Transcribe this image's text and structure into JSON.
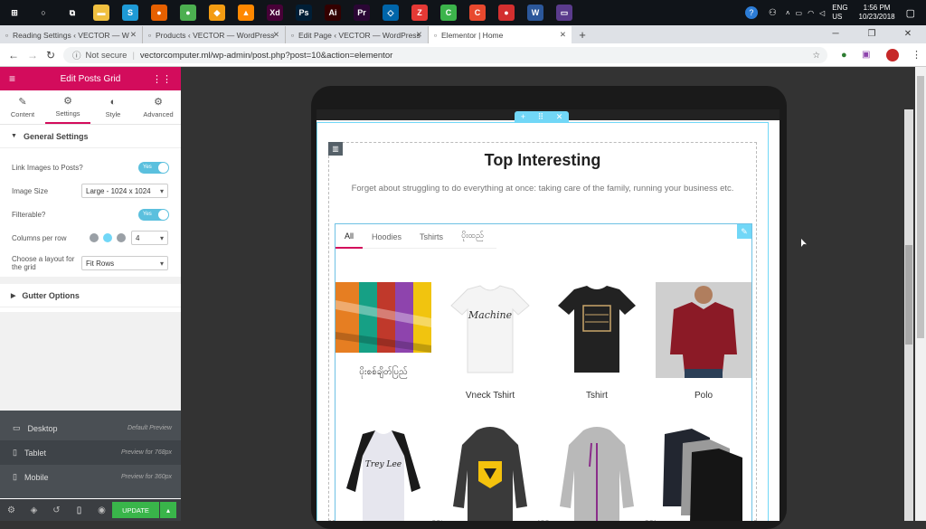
{
  "taskbar": {
    "apps": [
      {
        "name": "windows-icon",
        "glyph": "⊞",
        "color": "#101419"
      },
      {
        "name": "cortana-icon",
        "glyph": "○",
        "color": "#101419"
      },
      {
        "name": "taskview-icon",
        "glyph": "⧉",
        "color": "#101419"
      },
      {
        "name": "file-explorer-icon",
        "glyph": "▬",
        "color": "#f0c040"
      },
      {
        "name": "app-s-icon",
        "glyph": "S",
        "color": "#1e9ad6"
      },
      {
        "name": "firefox-icon",
        "glyph": "●",
        "color": "#e66000"
      },
      {
        "name": "chrome-icon",
        "glyph": "●",
        "color": "#4caf50"
      },
      {
        "name": "fl-studio-icon",
        "glyph": "◆",
        "color": "#f39c12"
      },
      {
        "name": "vlc-icon",
        "glyph": "▲",
        "color": "#ff8800"
      },
      {
        "name": "adobe-xd-icon",
        "glyph": "Xd",
        "color": "#470137"
      },
      {
        "name": "photoshop-icon",
        "glyph": "Ps",
        "color": "#001e36"
      },
      {
        "name": "illustrator-icon",
        "glyph": "Ai",
        "color": "#330000"
      },
      {
        "name": "premiere-icon",
        "glyph": "Pr",
        "color": "#2a0634"
      },
      {
        "name": "vscode-icon",
        "glyph": "◇",
        "color": "#0065a9"
      },
      {
        "name": "app-red-icon",
        "glyph": "Z",
        "color": "#e53935"
      },
      {
        "name": "camtasia-green-icon",
        "glyph": "C",
        "color": "#3cb44b"
      },
      {
        "name": "camtasia-orange-icon",
        "glyph": "C",
        "color": "#e8492e"
      },
      {
        "name": "chrome-profile-icon",
        "glyph": "●",
        "color": "#d32f2f"
      },
      {
        "name": "word-icon",
        "glyph": "W",
        "color": "#2b579a"
      },
      {
        "name": "terminal-icon",
        "glyph": "▭",
        "color": "#5a3b8c"
      }
    ],
    "lang": "ENG",
    "region": "US",
    "time": "1:56 PM",
    "date": "10/23/2018"
  },
  "browser": {
    "tabs": [
      {
        "label": "Reading Settings ‹ VECTOR — W",
        "active": false
      },
      {
        "label": "Products ‹ VECTOR — WordPress",
        "active": false
      },
      {
        "label": "Edit Page ‹ VECTOR — WordPress",
        "active": false
      },
      {
        "label": "Elementor | Home",
        "active": true
      }
    ],
    "security": "Not secure",
    "url": "vectorcomputer.ml/wp-admin/post.php?post=10&action=elementor"
  },
  "panel": {
    "title": "Edit Posts Grid",
    "tabs": [
      {
        "label": "Content",
        "icon": "pencil-icon",
        "glyph": "✎"
      },
      {
        "label": "Settings",
        "icon": "gear-icon",
        "glyph": "⚙"
      },
      {
        "label": "Style",
        "icon": "contrast-icon",
        "glyph": "◐"
      },
      {
        "label": "Advanced",
        "icon": "gear-icon",
        "glyph": "⚙"
      }
    ],
    "general_section": "General Settings",
    "link_images_label": "Link Images to Posts?",
    "link_images_value": "Yes",
    "image_size_label": "Image Size",
    "image_size_value": "Large - 1024 x 1024",
    "filterable_label": "Filterable?",
    "filterable_value": "Yes",
    "columns_label": "Columns per row",
    "columns_value": "4",
    "layout_label": "Choose a layout for the grid",
    "layout_value": "Fit Rows",
    "gutter_section": "Gutter Options",
    "devices": [
      {
        "label": "Desktop",
        "hint": "Default Preview",
        "icon": "desktop-icon",
        "glyph": "🖵"
      },
      {
        "label": "Tablet",
        "hint": "Preview for 768px",
        "icon": "tablet-icon",
        "glyph": "▯"
      },
      {
        "label": "Mobile",
        "hint": "Preview for 360px",
        "icon": "mobile-icon",
        "glyph": "▯"
      }
    ],
    "update_label": "UPDATE"
  },
  "preview": {
    "title": "Top Interesting",
    "subtitle": "Forget about struggling to do everything at once: taking care of the family, running your business etc.",
    "filters": [
      "All",
      "Hoodies",
      "Tshirts",
      "ပိုးထည်"
    ],
    "row1": [
      {
        "title": "ပိုးစစ်ချိတ်ပြည်",
        "color": "#d8a32b"
      },
      {
        "title": "Vneck  Tshirt",
        "color": "#f2f2f2"
      },
      {
        "title": "Tshirt",
        "color": "#222222"
      },
      {
        "title": "Polo",
        "color": "#8b1a26"
      }
    ],
    "row2": [
      {
        "title": "",
        "color": "#cfcfd8"
      },
      {
        "title": "",
        "color": "#3a3a3a"
      },
      {
        "title": "",
        "color": "#b9b9b9"
      },
      {
        "title": "",
        "color": "#222630"
      }
    ]
  }
}
